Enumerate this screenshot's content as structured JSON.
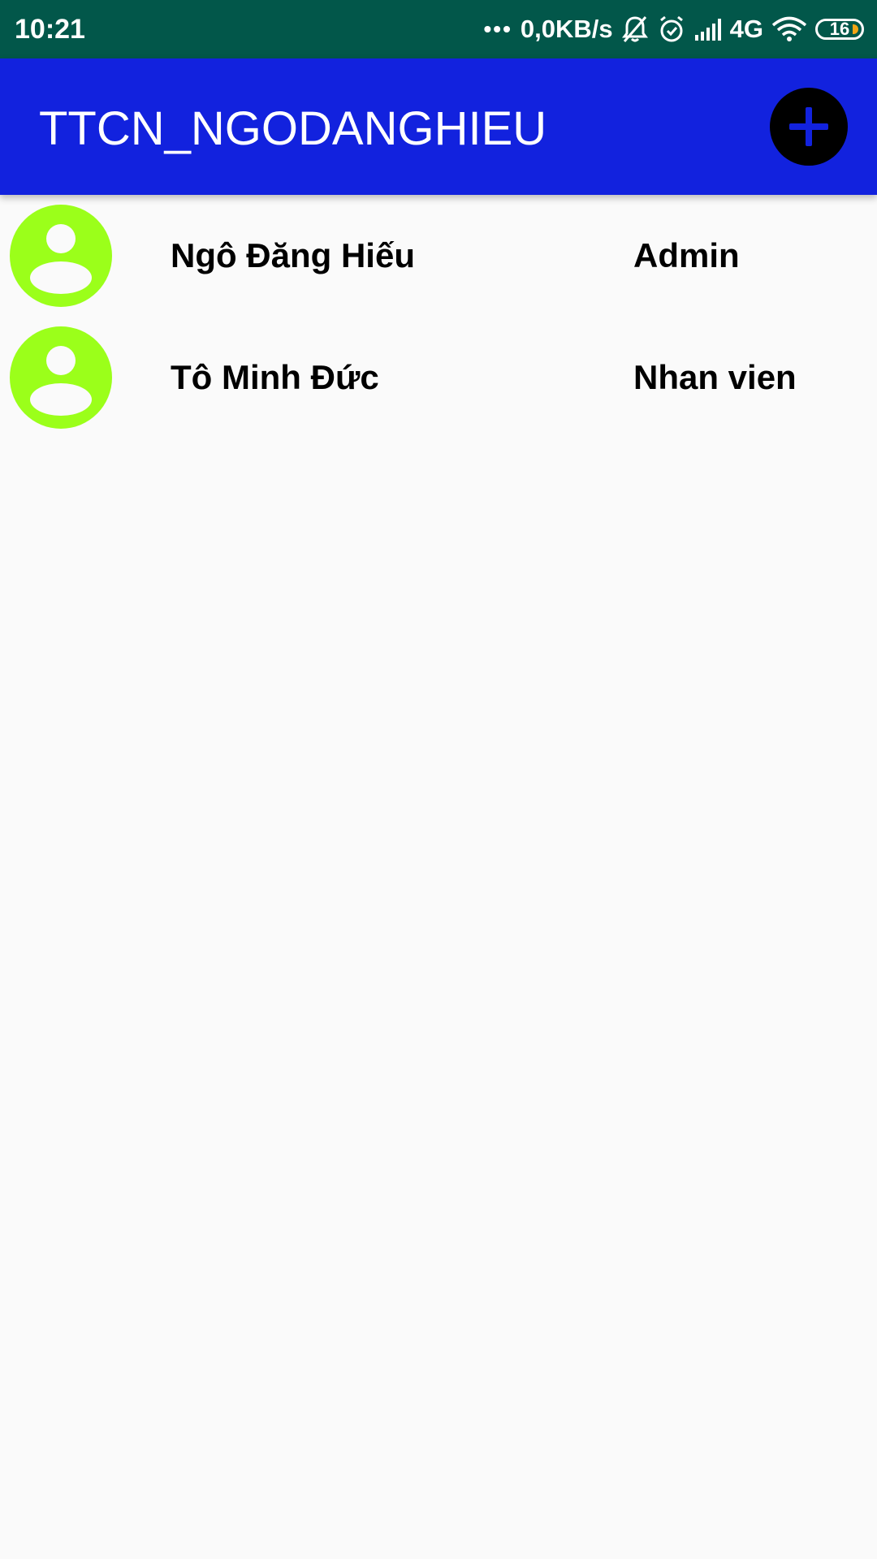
{
  "status_bar": {
    "time": "10:21",
    "dots": "•••",
    "net_speed": "0,0KB/s",
    "network_type": "4G",
    "battery_level": "16",
    "icons": [
      "muted-bell-icon",
      "alarm-icon",
      "signal-icon",
      "wifi-icon"
    ],
    "colors": {
      "background": "#02574a",
      "battery_fill": "#f4a515"
    }
  },
  "app_bar": {
    "title": "TTCN_NGODANGHIEU",
    "add_button_icon": "plus-icon",
    "colors": {
      "background": "#1222de",
      "button": "#000000",
      "plus": "#1222de"
    }
  },
  "users": [
    {
      "name": "Ngô Đăng Hiếu",
      "role": "Admin",
      "avatar_icon": "user-avatar-icon"
    },
    {
      "name": "Tô Minh Đức",
      "role": "Nhan vien",
      "avatar_icon": "user-avatar-icon"
    }
  ],
  "colors": {
    "avatar": "#9bff1a",
    "page_background": "#fafafa"
  }
}
